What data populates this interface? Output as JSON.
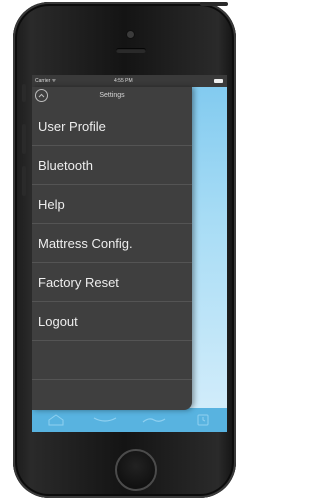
{
  "status_bar": {
    "carrier": "Carrier ᯤ",
    "time": "4:55 PM"
  },
  "drawer": {
    "title": "Settings",
    "items": [
      {
        "label": "User Profile"
      },
      {
        "label": "Bluetooth"
      },
      {
        "label": "Help"
      },
      {
        "label": "Mattress Config."
      },
      {
        "label": "Factory Reset"
      },
      {
        "label": "Logout"
      }
    ]
  },
  "tabbar": {
    "tabs": [
      {
        "icon": "home-icon"
      },
      {
        "icon": "wave-icon"
      },
      {
        "icon": "wave-alt-icon"
      },
      {
        "icon": "clock-icon"
      }
    ]
  },
  "colors": {
    "drawer_bg": "#3f3f3f",
    "tabbar_bg": "#58b3e0",
    "screen_bg": "#a7dcf5"
  }
}
